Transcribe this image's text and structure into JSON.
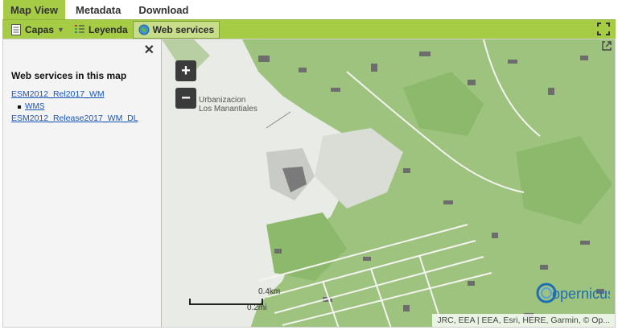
{
  "tabs": [
    {
      "label": "Map View",
      "active": true
    },
    {
      "label": "Metadata",
      "active": false
    },
    {
      "label": "Download",
      "active": false
    }
  ],
  "toolbar": {
    "layers_label": "Capas",
    "legend_label": "Leyenda",
    "webservices_label": "Web services",
    "active": "webservices"
  },
  "panel": {
    "title": "Web services in this map",
    "services": [
      {
        "label": "ESM2012_Rel2017_WM",
        "sub": [
          "WMS"
        ]
      },
      {
        "label": "ESM2012_Release2017_WM_DL",
        "sub": []
      }
    ]
  },
  "map": {
    "zoom_in": "+",
    "zoom_out": "−",
    "place_label_line1": "Urbanizacion",
    "place_label_line2": "Los Manantiales",
    "scale_km": "0.4km",
    "scale_mi": "0.2mi",
    "logo_text": "opernicus",
    "attribution": "JRC, EEA | EEA, Esri, HERE, Garmin, © Op...",
    "colors": {
      "vegetation": "#9dc37e",
      "urban": "#6d6d6d",
      "background": "#e9ece6",
      "accent": "#a6cb45"
    }
  }
}
